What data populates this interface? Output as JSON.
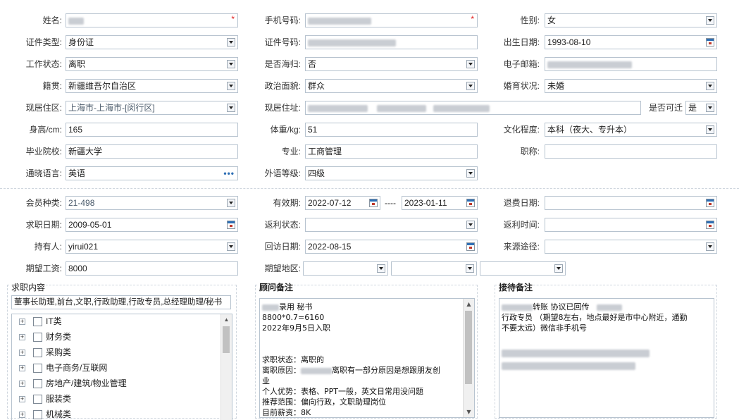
{
  "row1": {
    "name_label": "姓名:",
    "phone_label": "手机号码:",
    "gender_label": "性别:",
    "gender_value": "女",
    "required_mark": "*"
  },
  "row2": {
    "idtype_label": "证件类型:",
    "idtype_value": "身份证",
    "idno_label": "证件号码:",
    "birth_label": "出生日期:",
    "birth_value": "1993-08-10"
  },
  "row3": {
    "work_label": "工作状态:",
    "work_value": "离职",
    "overseas_label": "是否海归:",
    "overseas_value": "否",
    "email_label": "电子邮箱:"
  },
  "row4": {
    "native_label": "籍贯:",
    "native_value": "新疆维吾尔自治区",
    "political_label": "政治面貌:",
    "political_value": "群众",
    "marital_label": "婚育状况:",
    "marital_value": "未婚"
  },
  "row5": {
    "area_label": "现居住区:",
    "area_value": "上海市-上海市-[闵行区]",
    "addr_label": "现居住址:",
    "relocate_label": "是否可迁",
    "relocate_value": "是"
  },
  "row6": {
    "height_label": "身高/cm:",
    "height_value": "165",
    "weight_label": "体重/kg:",
    "weight_value": "51",
    "edu_label": "文化程度:",
    "edu_value": "本科（夜大、专升本）"
  },
  "row7": {
    "school_label": "毕业院校:",
    "school_value": "新疆大学",
    "major_label": "专业:",
    "major_value": "工商管理",
    "title_label": "职称:",
    "title_value": ""
  },
  "row8": {
    "lang_label": "通晓语言:",
    "lang_value": "英语",
    "lang_more": "•••",
    "level_label": "外语等级:",
    "level_value": "四级"
  },
  "row9": {
    "member_label": "会员种类:",
    "member_value": "21-498",
    "valid_label": "有效期:",
    "valid_from": "2022-07-12",
    "valid_sep": "----",
    "valid_to": "2023-01-11",
    "refund_label": "退费日期:",
    "refund_value": ""
  },
  "row10": {
    "jobdate_label": "求职日期:",
    "jobdate_value": "2009-05-01",
    "rebate_label": "返利状态:",
    "rebate_value": "",
    "rebatetime_label": "返利时间:",
    "rebatetime_value": ""
  },
  "row11": {
    "holder_label": "持有人:",
    "holder_value": "yirui021",
    "visit_label": "回访日期:",
    "visit_value": "2022-08-15",
    "source_label": "来源途径:",
    "source_value": ""
  },
  "row12": {
    "salary_label": "期望工资:",
    "salary_value": "8000",
    "region_label": "期望地区:"
  },
  "jobpanel": {
    "title": "求职内容",
    "summary": "董事长助理,前台,文职,行政助理,行政专员,总经理助理/秘书",
    "categories": [
      "IT类",
      "财务类",
      "采购类",
      "电子商务/互联网",
      "房地产/建筑/物业管理",
      "服装类",
      "机械类"
    ]
  },
  "advisor": {
    "title": "顾问备注",
    "lines": [
      "录用 秘书",
      "8800*0.7=6160",
      "2022年9月5日入职",
      "",
      "",
      "求职状态：离职的",
      "离职原因：",
      "离职有一部分原因是想跟朋友创",
      "业",
      "个人优势：表格、PPT一般，英文日常用没问题",
      "推荐范围：偏向行政，文职助理岗位",
      "目前薪资：8K"
    ]
  },
  "reception": {
    "title": "接待备注",
    "lines": [
      "转账  协议已回传",
      "行政专员  （期望8左右，地点最好是市中心附近，通勤",
      "不要太远）微信非手机号"
    ]
  },
  "icons": {
    "expand": "⊞",
    "scroll_up": "▲",
    "scroll_down": "▼"
  },
  "colors": {
    "border": "#b7c3cf",
    "required": "#e02020",
    "accent": "#2e6fb5"
  }
}
